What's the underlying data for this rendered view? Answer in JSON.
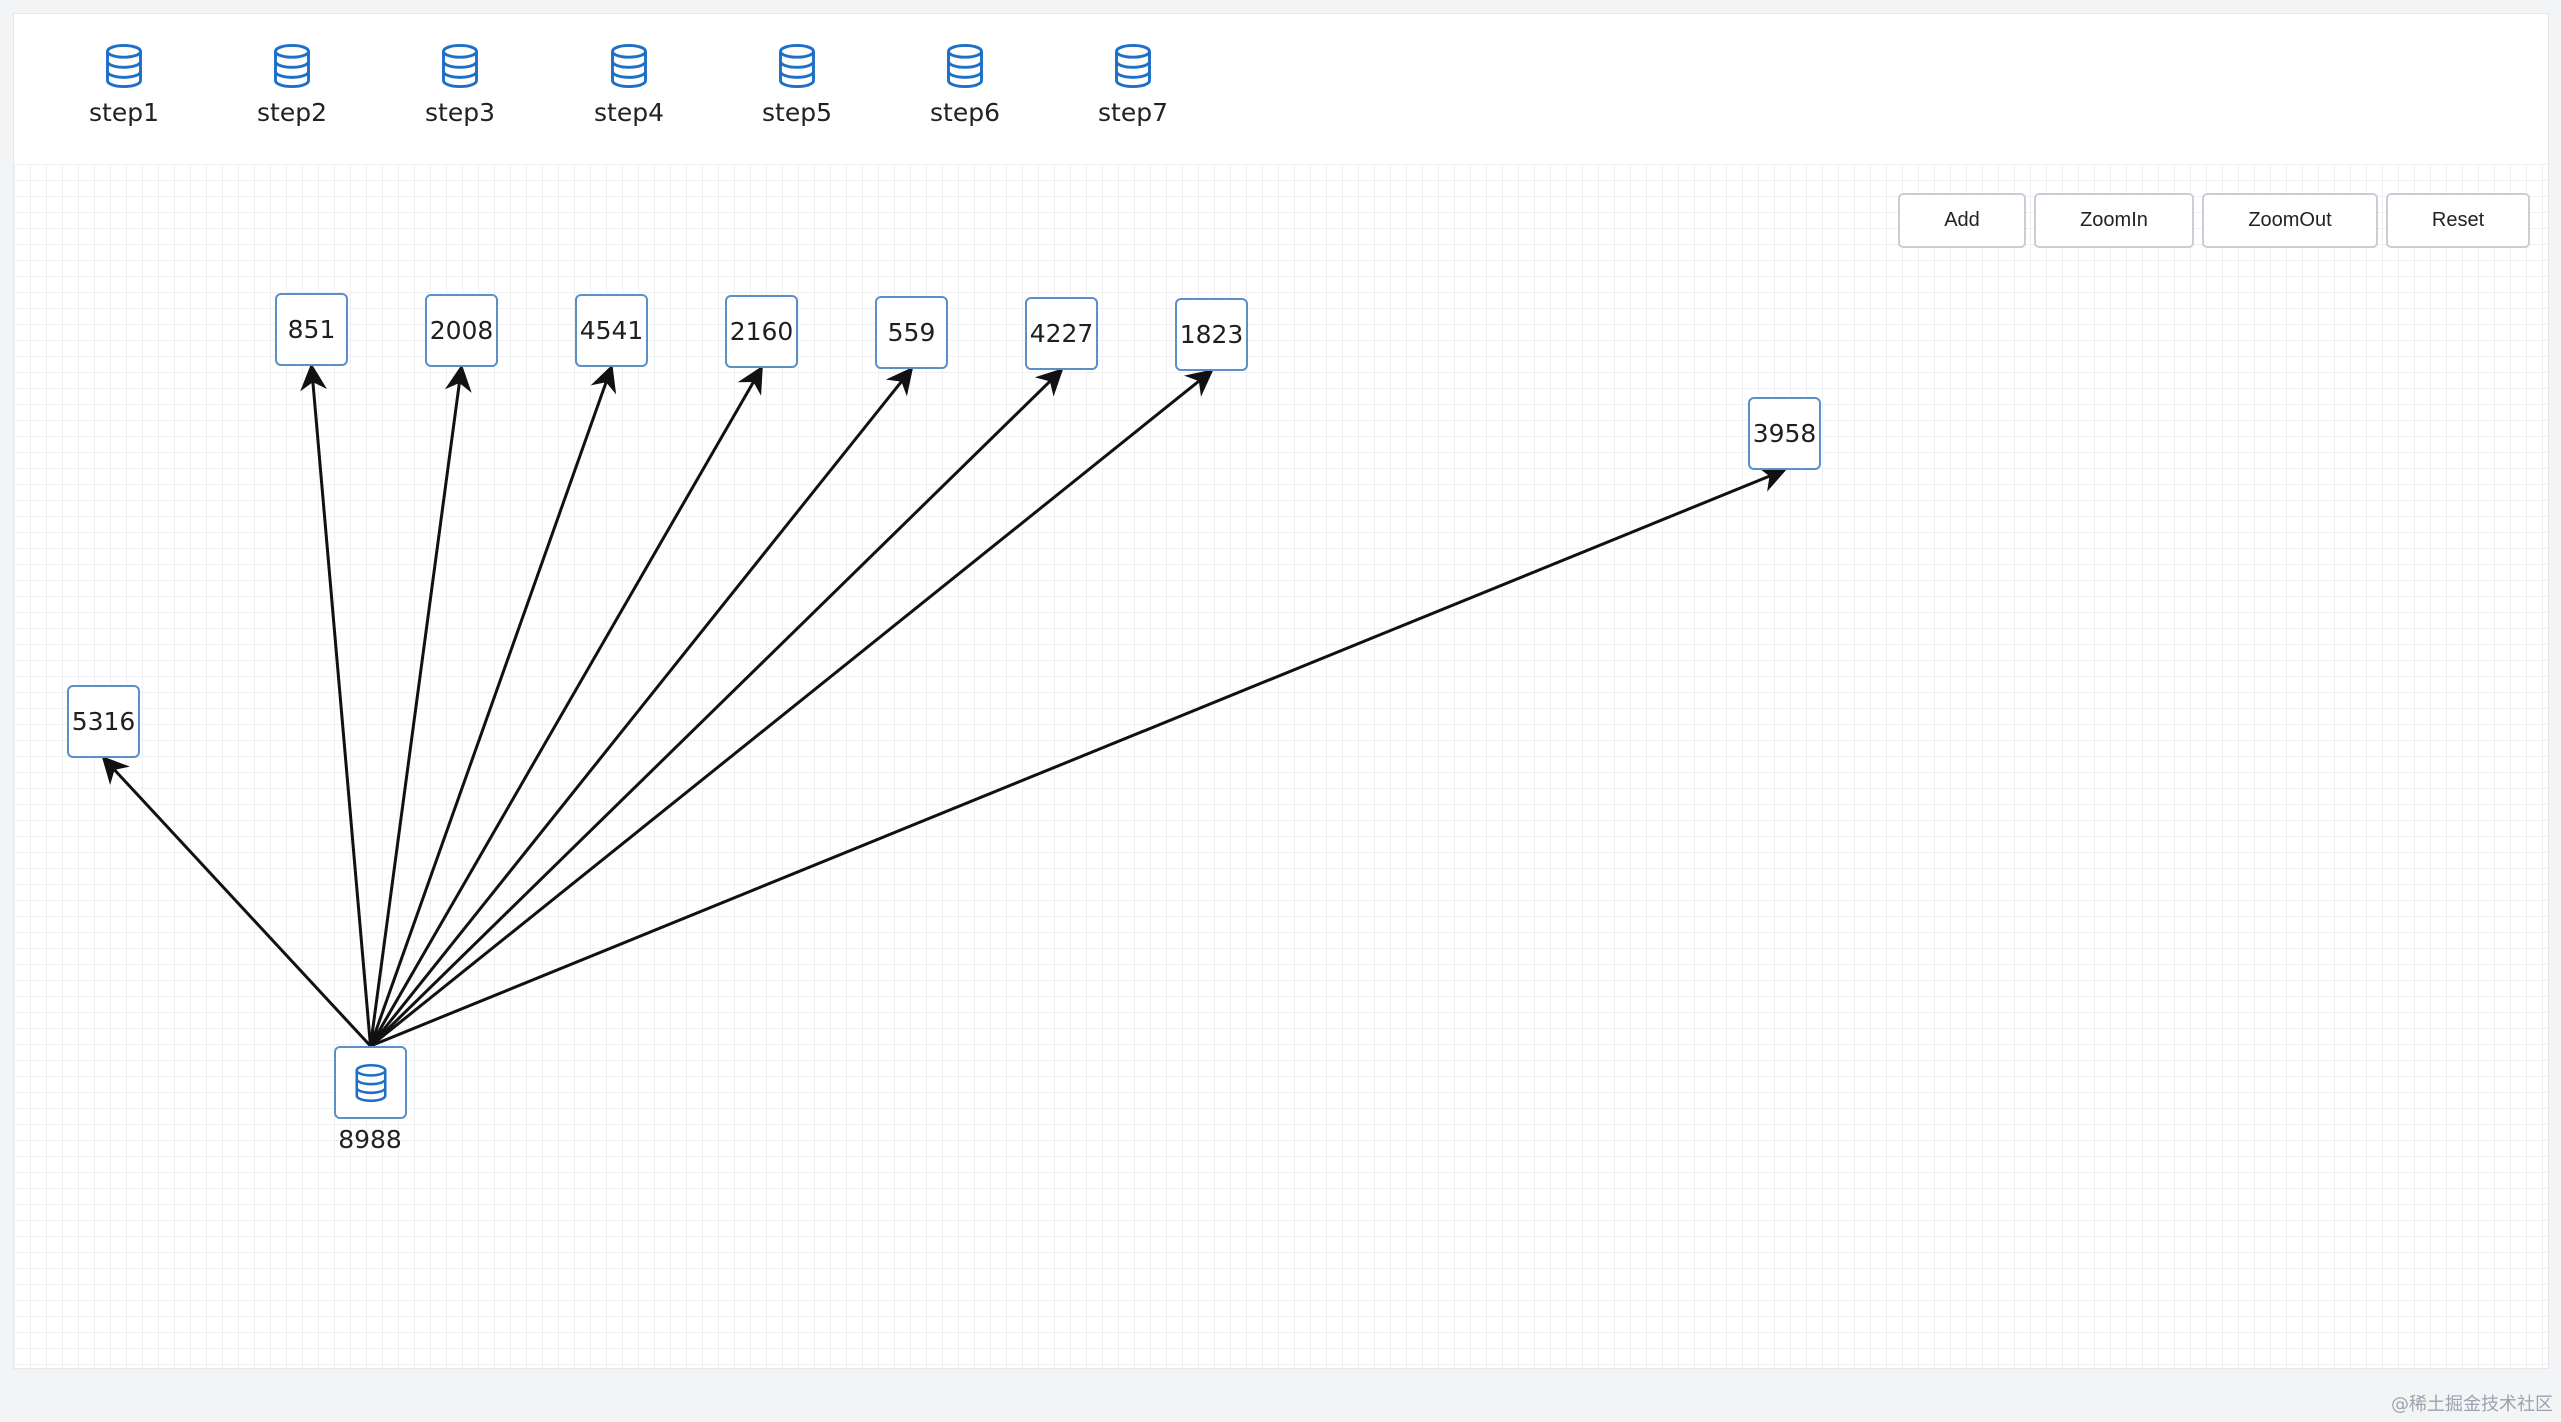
{
  "palette": {
    "items": [
      {
        "label": "step1",
        "icon": "database-icon"
      },
      {
        "label": "step2",
        "icon": "database-icon"
      },
      {
        "label": "step3",
        "icon": "database-icon"
      },
      {
        "label": "step4",
        "icon": "database-icon"
      },
      {
        "label": "step5",
        "icon": "database-icon"
      },
      {
        "label": "step6",
        "icon": "database-icon"
      },
      {
        "label": "step7",
        "icon": "database-icon"
      }
    ]
  },
  "toolbar": {
    "add_label": "Add",
    "zoomin_label": "ZoomIn",
    "zoomout_label": "ZoomOut",
    "reset_label": "Reset"
  },
  "graph": {
    "root": {
      "label": "8988",
      "icon": "database-icon"
    },
    "nodes": [
      {
        "label": "851"
      },
      {
        "label": "2008"
      },
      {
        "label": "4541"
      },
      {
        "label": "2160"
      },
      {
        "label": "559"
      },
      {
        "label": "4227"
      },
      {
        "label": "1823"
      },
      {
        "label": "3958"
      },
      {
        "label": "5316"
      }
    ],
    "edge_color": "#111111",
    "node_border_color": "#5b8fc7",
    "icon_color": "#1e6fc8"
  },
  "watermark": "@稀土掘金技术社区"
}
